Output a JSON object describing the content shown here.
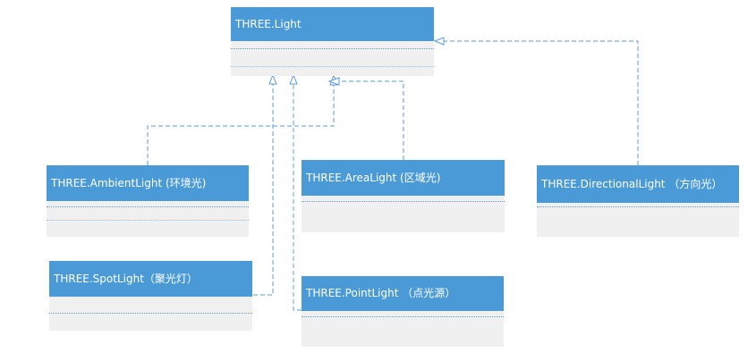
{
  "diagram": {
    "base": {
      "label": "THREE.Light"
    },
    "subclasses": [
      {
        "key": "ambient",
        "label": "THREE.AmbientLight (环境光)"
      },
      {
        "key": "area",
        "label": "THREE.AreaLight (区域光)"
      },
      {
        "key": "directional",
        "label": "THREE.DirectionalLight （方向光）"
      },
      {
        "key": "spot",
        "label": "THREE.SpotLight（聚光灯）"
      },
      {
        "key": "point",
        "label": "THREE.PointLight （点光源）"
      }
    ],
    "colors": {
      "header": "#4a9ad8",
      "body": "#f0f0f0",
      "connector": "#5b9bd5",
      "header_text": "#ffffff"
    }
  }
}
